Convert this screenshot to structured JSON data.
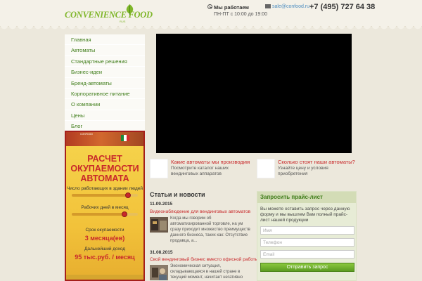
{
  "header": {
    "logo_text": "CONVENIENCE FOOD",
    "logo_sub": "RUS",
    "hours_title": "Мы работаем",
    "hours_time": "ПН-ПТ с 10:00 до 19:00",
    "email": "sale@confood.ru",
    "phone": "+7 (495) 727 64 38"
  },
  "nav": {
    "items": [
      {
        "label": "Главная"
      },
      {
        "label": "Автоматы"
      },
      {
        "label": "Стандартные решения"
      },
      {
        "label": "Бизнес-идеи"
      },
      {
        "label": "Бренд-автоматы"
      },
      {
        "label": "Корпоративное питание"
      },
      {
        "label": "О компании"
      },
      {
        "label": "Цены"
      },
      {
        "label": "Блог"
      }
    ]
  },
  "calculator": {
    "tiny_label": "CONFOOD",
    "title_line1": "РАСЧЕТ",
    "title_line2": "ОКУПАЕМОСТИ",
    "title_line3": "АВТОМАТА",
    "label_people": "Число работающих в здании людей",
    "people_level": 0.85,
    "label_days": "Рабочих дней в месяц",
    "days_level": 0.8,
    "label_payback": "Срок окупаемости",
    "payback_value": "3 месяца(ев)",
    "label_income": "Дальнейший доход",
    "income_value": "95 тыс.руб. / месяц"
  },
  "services": [
    {
      "title": "Какие автоматы мы производим",
      "desc": "Посмотрите каталог наших вендинговых аппаратов"
    },
    {
      "title": "Сколько стоят наши автоматы?",
      "desc": "Узнайте цену и условия приобретения"
    }
  ],
  "news": {
    "heading": "Статьи и новости",
    "items": [
      {
        "date": "11.09.2015",
        "title": "Видеонаблюдение для вендинговых автоматов",
        "text": "Когда мы говорим об автоматизированной торговле, на ум сразу приходит множество преимуществ данного бизнеса, таких как: Отсутствие продавца, а..."
      },
      {
        "date": "31.08.2015",
        "title": "Свой вендинговый бизнес вместо офисной работы",
        "text": "Экономическая ситуация, складывающаяся в нашей стране в текущий момент, начитает негативно"
      }
    ]
  },
  "price_request": {
    "title": "Запросить прайс-лист",
    "desc": "Вы можете оставить запрос через данную форму и мы вышлем Вам полный прайс-лист нашей продукции",
    "name_placeholder": "Имя",
    "phone_placeholder": "Телефон",
    "email_placeholder": "Email",
    "button": "Отправить запрос"
  },
  "colors": {
    "brand_green": "#7fb62a",
    "accent_red": "#c8282a",
    "calculator_yellow": "#f5d24a"
  }
}
